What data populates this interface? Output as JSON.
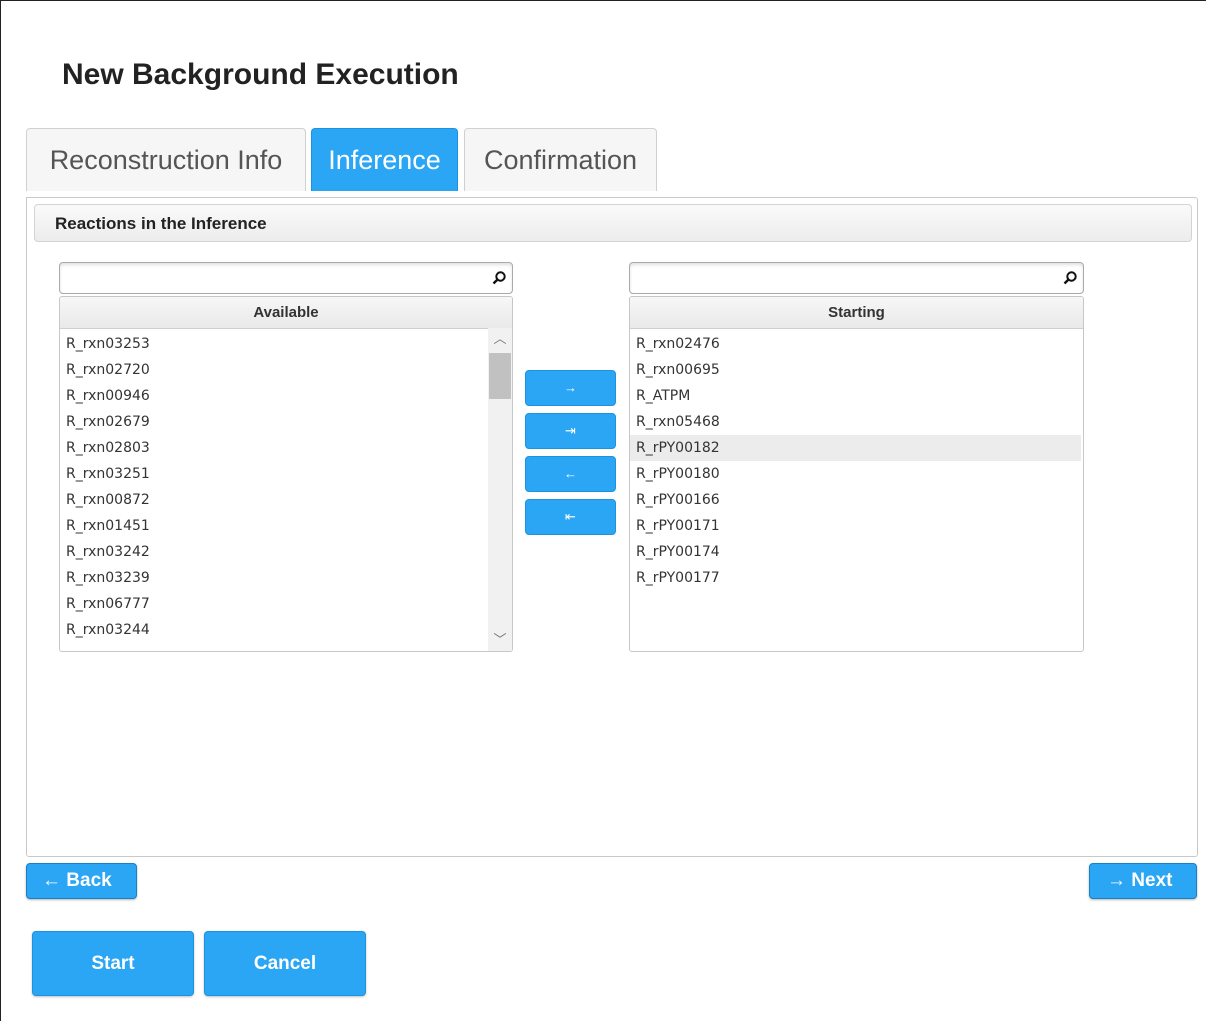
{
  "title": "New Background Execution",
  "tabs": [
    {
      "label": "Reconstruction Info"
    },
    {
      "label": "Inference",
      "active": true
    },
    {
      "label": "Confirmation"
    }
  ],
  "panel": {
    "header": "Reactions in the Inference"
  },
  "available": {
    "header": "Available",
    "filter_value": "",
    "items": [
      "R_rxn03253",
      "R_rxn02720",
      "R_rxn00946",
      "R_rxn02679",
      "R_rxn02803",
      "R_rxn03251",
      "R_rxn00872",
      "R_rxn01451",
      "R_rxn03242",
      "R_rxn03239",
      "R_rxn06777",
      "R_rxn03244"
    ]
  },
  "starting": {
    "header": "Starting",
    "filter_value": "",
    "items": [
      "R_rxn02476",
      "R_rxn00695",
      "R_ATPM",
      "R_rxn05468",
      "R_rPY00182",
      "R_rPY00180",
      "R_rPY00166",
      "R_rPY00171",
      "R_rPY00174",
      "R_rPY00177"
    ],
    "highlighted": "R_rPY00182"
  },
  "move_buttons": {
    "add": "→",
    "add_all": "⇥",
    "remove": "←",
    "remove_all": "⇤"
  },
  "nav": {
    "back": "← Back",
    "next": "→ Next"
  },
  "actions": {
    "start": "Start",
    "cancel": "Cancel"
  },
  "colors": {
    "accent": "#2aa6f5"
  }
}
